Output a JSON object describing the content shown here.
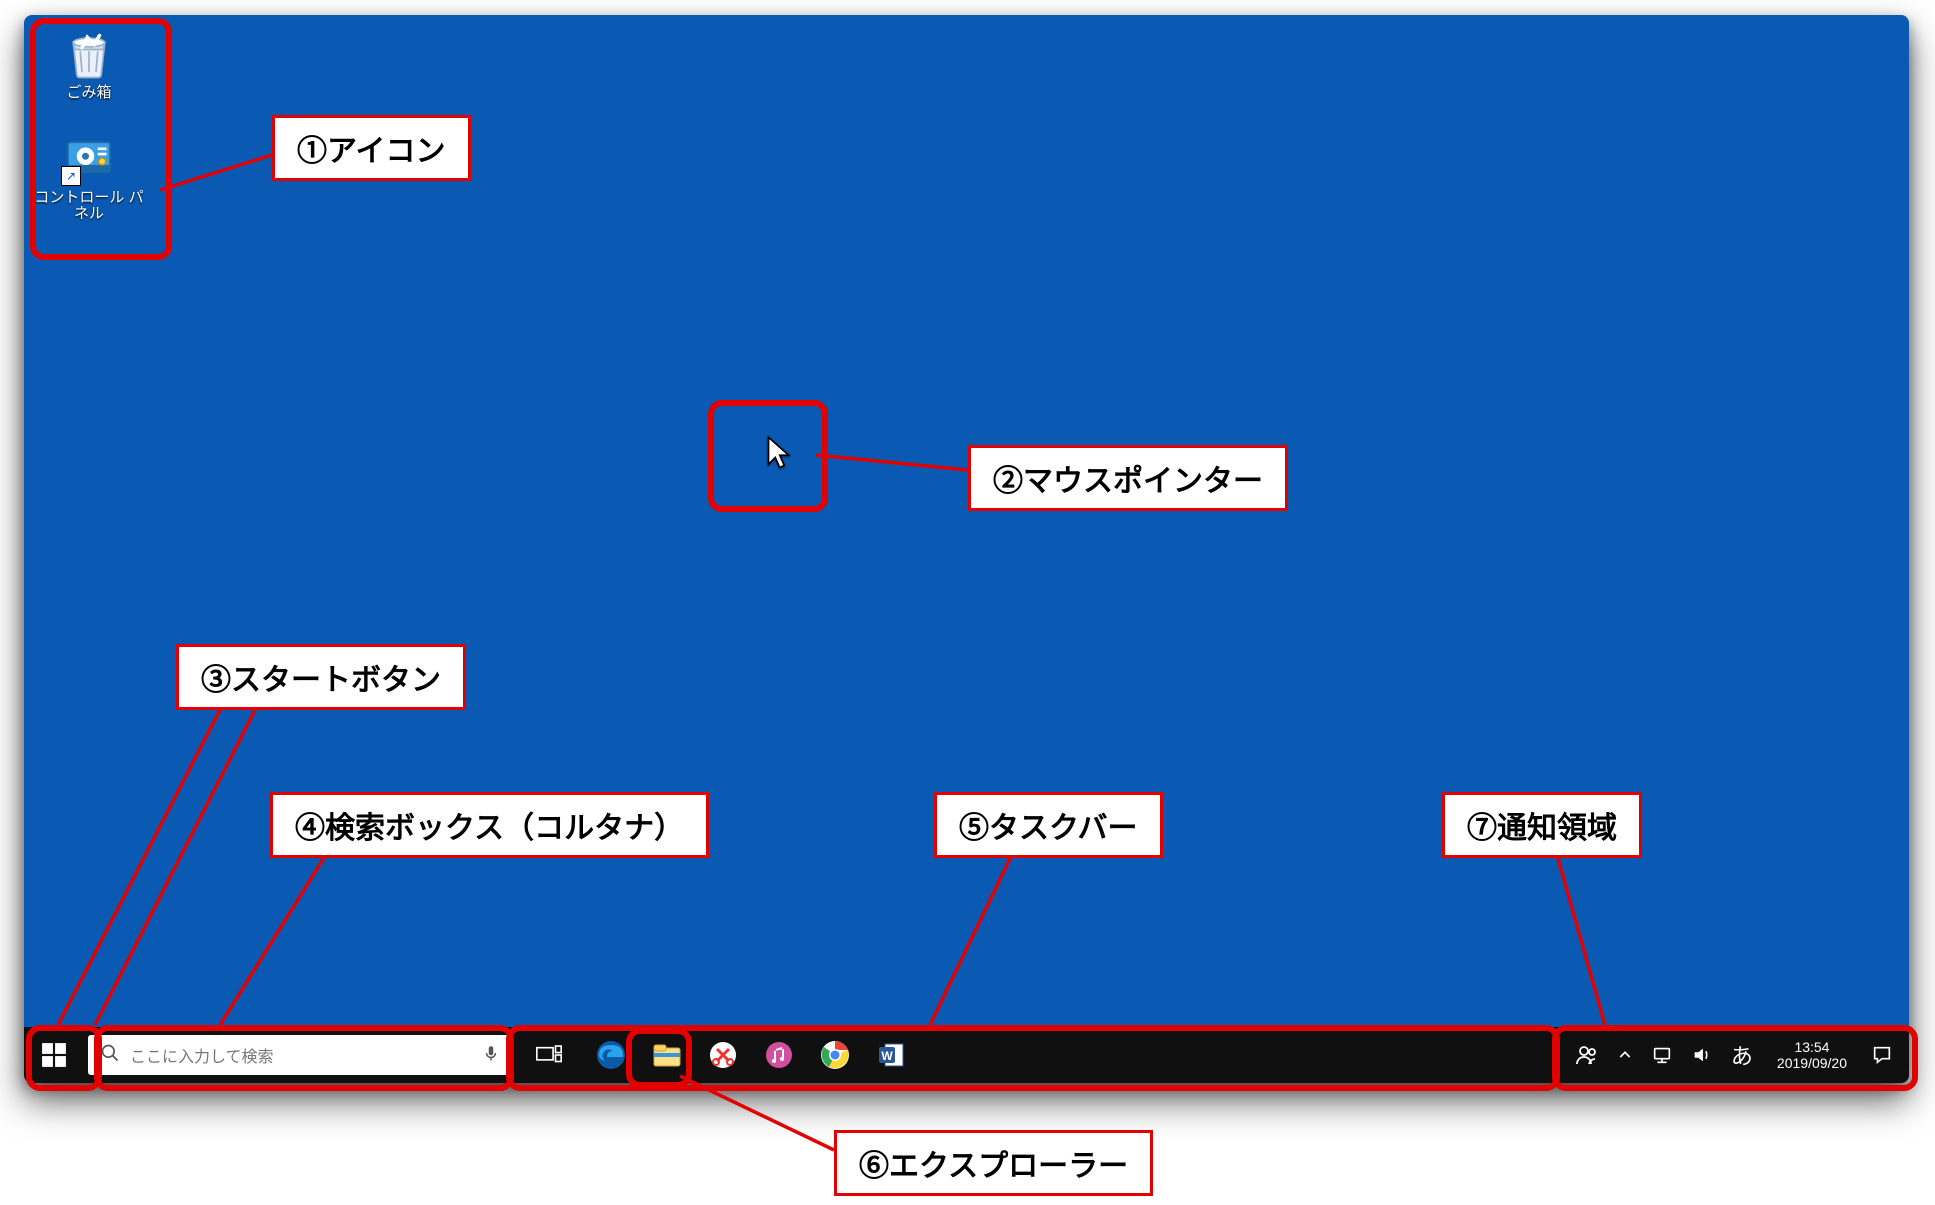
{
  "desktop": {
    "icons": [
      {
        "id": "recycle-bin",
        "label": "ごみ箱"
      },
      {
        "id": "control-panel",
        "label": "コントロール パネル"
      }
    ]
  },
  "taskbar": {
    "search_placeholder": "ここに入力して検索",
    "ime_indicator": "あ",
    "clock": {
      "time": "13:54",
      "date": "2019/09/20"
    },
    "pins": [
      {
        "id": "edge",
        "name": "edge-icon"
      },
      {
        "id": "explorer",
        "name": "file-explorer-icon"
      },
      {
        "id": "snip",
        "name": "snip-icon"
      },
      {
        "id": "media",
        "name": "media-icon"
      },
      {
        "id": "chrome",
        "name": "chrome-icon"
      },
      {
        "id": "word",
        "name": "word-icon"
      }
    ]
  },
  "callouts": {
    "c1": "①アイコン",
    "c2": "②マウスポインター",
    "c3": "③スタートボタン",
    "c4": "④検索ボックス（コルタナ）",
    "c5": "⑤タスクバー",
    "c6": "⑥エクスプローラー",
    "c7": "⑦通知領域"
  }
}
